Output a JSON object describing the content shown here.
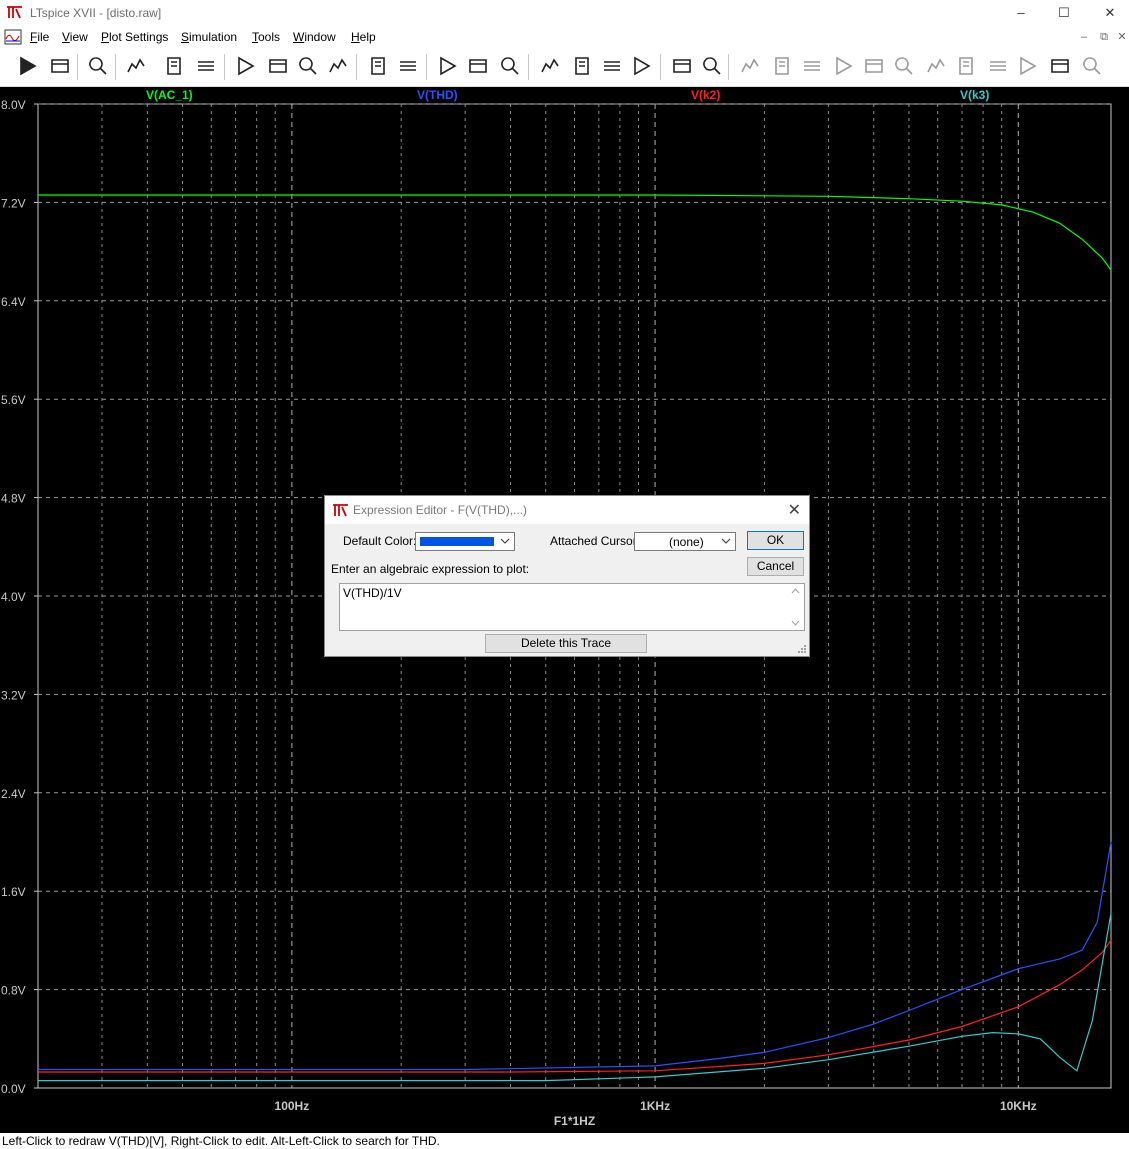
{
  "window": {
    "title": "LTspice XVII - [disto.raw]"
  },
  "menu": {
    "items": [
      {
        "label": "File",
        "accel": "F",
        "rest": "ile"
      },
      {
        "label": "View",
        "accel": "V",
        "rest": "iew"
      },
      {
        "label": "Plot Settings",
        "accel": "P",
        "rest": "lot Settings"
      },
      {
        "label": "Simulation",
        "accel": "S",
        "rest": "imulation"
      },
      {
        "label": "Tools",
        "accel": "T",
        "rest": "ools"
      },
      {
        "label": "Window",
        "accel": "W",
        "rest": "indow"
      },
      {
        "label": "Help",
        "accel": "H",
        "rest": "elp"
      }
    ]
  },
  "toolbar": {
    "icons": [
      "run-icon",
      "open-folder-icon",
      "save-icon",
      "control-panel-icon",
      "probe-icon",
      "pan-hand-icon",
      "zoom-in-icon",
      "zoom-full-icon",
      "zoom-out-icon",
      "zoom-cancel-icon",
      "autorange-icon",
      "new-plot-pane-icon",
      "tile-horizontal-icon",
      "cascade-icon",
      "tile-vertical-icon",
      "cut-icon",
      "copy-icon",
      "paste-icon",
      "find-icon",
      "print-preview-icon",
      "print-icon",
      "wire-icon",
      "ground-icon",
      "label-icon",
      "resistor-icon",
      "capacitor-icon",
      "inductor-icon",
      "diode-icon",
      "component-icon",
      "move-icon",
      "drag-icon",
      "undo-icon",
      "redo-icon",
      "text-icon"
    ]
  },
  "chart_data": {
    "type": "line",
    "x_scale": "log",
    "xlim": [
      20,
      18000
    ],
    "ylim": [
      0,
      8
    ],
    "grid": true,
    "xlabel": "F1*1HZ",
    "y_ticks": [
      "0.0V",
      "0.8V",
      "1.6V",
      "2.4V",
      "3.2V",
      "4.0V",
      "4.8V",
      "5.6V",
      "6.4V",
      "7.2V",
      "8.0V"
    ],
    "x_ticks": [
      {
        "v": 100,
        "label": "100Hz"
      },
      {
        "v": 1000,
        "label": "1KHz"
      },
      {
        "v": 10000,
        "label": "10KHz"
      }
    ],
    "series": [
      {
        "name": "V(AC_1)",
        "color": "#00ff00",
        "points": [
          [
            20,
            7.26
          ],
          [
            200,
            7.26
          ],
          [
            1000,
            7.26
          ],
          [
            3000,
            7.25
          ],
          [
            5000,
            7.23
          ],
          [
            7000,
            7.21
          ],
          [
            9000,
            7.18
          ],
          [
            11000,
            7.12
          ],
          [
            13000,
            7.03
          ],
          [
            15000,
            6.9
          ],
          [
            17000,
            6.75
          ],
          [
            18000,
            6.65
          ]
        ]
      },
      {
        "name": "V(THD)",
        "color": "#2255ff",
        "points": [
          [
            20,
            0.15
          ],
          [
            300,
            0.15
          ],
          [
            1000,
            0.18
          ],
          [
            1500,
            0.24
          ],
          [
            2000,
            0.29
          ],
          [
            3000,
            0.41
          ],
          [
            4000,
            0.52
          ],
          [
            5000,
            0.63
          ],
          [
            7000,
            0.8
          ],
          [
            10000,
            0.97
          ],
          [
            13000,
            1.05
          ],
          [
            15000,
            1.12
          ],
          [
            16500,
            1.35
          ],
          [
            18000,
            2.0
          ]
        ]
      },
      {
        "name": "V(k2)",
        "color": "#ff2020",
        "points": [
          [
            20,
            0.13
          ],
          [
            400,
            0.13
          ],
          [
            1000,
            0.14
          ],
          [
            2000,
            0.2
          ],
          [
            3000,
            0.27
          ],
          [
            5000,
            0.39
          ],
          [
            7000,
            0.5
          ],
          [
            10000,
            0.66
          ],
          [
            13000,
            0.84
          ],
          [
            15000,
            0.96
          ],
          [
            17000,
            1.1
          ],
          [
            18000,
            1.2
          ]
        ]
      },
      {
        "name": "V(k3)",
        "color": "#33cccc",
        "points": [
          [
            20,
            0.06
          ],
          [
            500,
            0.06
          ],
          [
            1000,
            0.09
          ],
          [
            2000,
            0.16
          ],
          [
            3000,
            0.23
          ],
          [
            5000,
            0.34
          ],
          [
            7000,
            0.42
          ],
          [
            8500,
            0.45
          ],
          [
            10000,
            0.44
          ],
          [
            11500,
            0.4
          ],
          [
            13000,
            0.25
          ],
          [
            14500,
            0.14
          ],
          [
            16000,
            0.55
          ],
          [
            17000,
            1.0
          ],
          [
            18000,
            1.42
          ]
        ]
      }
    ]
  },
  "dialog": {
    "title": "Expression Editor - F(V(THD),...)",
    "default_color_label": "Default Color:",
    "default_color": "#0055e6",
    "attached_cursor_label": "Attached Cursor:",
    "attached_cursor_value": "(none)",
    "ok_label": "OK",
    "cancel_label": "Cancel",
    "expr_label": "Enter an algebraic expression to plot:",
    "expression": "V(THD)/1V",
    "delete_label": "Delete this Trace"
  },
  "status": {
    "text": "Left-Click to redraw V(THD)[V],  Right-Click to edit. Alt-Left-Click to search for THD."
  }
}
